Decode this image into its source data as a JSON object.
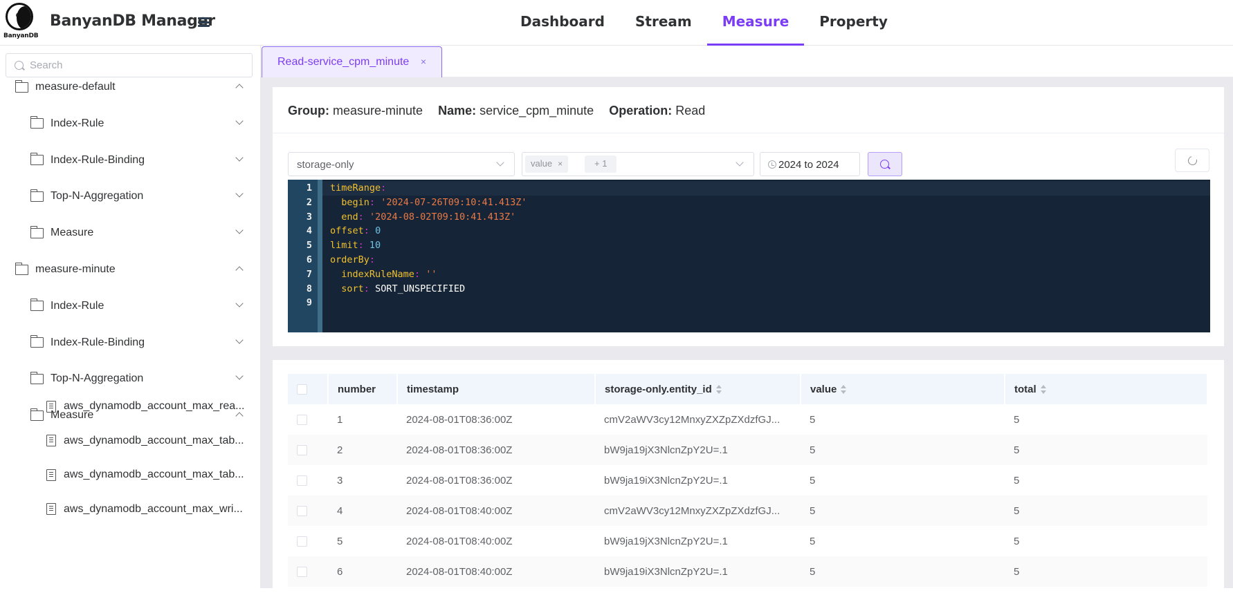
{
  "header": {
    "logo_text": "BanyanDB",
    "app_title": "BanyanDB Manager",
    "nav": [
      {
        "label": "Dashboard",
        "active": false
      },
      {
        "label": "Stream",
        "active": false
      },
      {
        "label": "Measure",
        "active": true
      },
      {
        "label": "Property",
        "active": false
      }
    ]
  },
  "sidebar": {
    "search_placeholder": "Search",
    "tree": [
      {
        "label": "measure-default",
        "level": 0,
        "icon": "folder-icon",
        "chevron": "up"
      },
      {
        "label": "Index-Rule",
        "level": 1,
        "icon": "folder-icon",
        "chevron": "down"
      },
      {
        "label": "Index-Rule-Binding",
        "level": 1,
        "icon": "folder-icon",
        "chevron": "down"
      },
      {
        "label": "Top-N-Aggregation",
        "level": 1,
        "icon": "folder-icon",
        "chevron": "down"
      },
      {
        "label": "Measure",
        "level": 1,
        "icon": "folder-icon",
        "chevron": "down"
      },
      {
        "label": "measure-minute",
        "level": 0,
        "icon": "folder-icon",
        "chevron": "up"
      },
      {
        "label": "Index-Rule",
        "level": 1,
        "icon": "folder-icon",
        "chevron": "down"
      },
      {
        "label": "Index-Rule-Binding",
        "level": 1,
        "icon": "folder-icon",
        "chevron": "down"
      },
      {
        "label": "Top-N-Aggregation",
        "level": 1,
        "icon": "folder-icon",
        "chevron": "down"
      },
      {
        "label": "Measure",
        "level": 1,
        "icon": "folder-icon",
        "chevron": "up"
      },
      {
        "label": "aws_dynamodb_account_max_rea...",
        "level": 2,
        "icon": "file-icon"
      },
      {
        "label": "aws_dynamodb_account_max_tab...",
        "level": 2,
        "icon": "file-icon"
      },
      {
        "label": "aws_dynamodb_account_max_tab...",
        "level": 2,
        "icon": "file-icon"
      },
      {
        "label": "aws_dynamodb_account_max_wri...",
        "level": 2,
        "icon": "file-icon"
      }
    ]
  },
  "tabs": [
    {
      "label": "Read-service_cpm_minute",
      "close": "×"
    }
  ],
  "info": {
    "group_label": "Group:",
    "group_value": "measure-minute",
    "name_label": "Name:",
    "name_value": "service_cpm_minute",
    "operation_label": "Operation:",
    "operation_value": "Read"
  },
  "query": {
    "tag_family_select": "storage-only",
    "fields_tags": [
      "value",
      "+ 1"
    ],
    "tag_close": "×",
    "date_range": "2024 to 2024"
  },
  "editor": {
    "lines": [
      {
        "n": "1",
        "indent": "",
        "key": "timeRange",
        "value": "",
        "vtype": ""
      },
      {
        "n": "2",
        "indent": "  ",
        "key": "begin",
        "value": "'2024-07-26T09:10:41.413Z'",
        "vtype": "s"
      },
      {
        "n": "3",
        "indent": "  ",
        "key": "end",
        "value": "'2024-08-02T09:10:41.413Z'",
        "vtype": "s"
      },
      {
        "n": "4",
        "indent": "",
        "key": "offset",
        "value": "0",
        "vtype": "n"
      },
      {
        "n": "5",
        "indent": "",
        "key": "limit",
        "value": "10",
        "vtype": "n"
      },
      {
        "n": "6",
        "indent": "",
        "key": "orderBy",
        "value": "",
        "vtype": ""
      },
      {
        "n": "7",
        "indent": "  ",
        "key": "indexRuleName",
        "value": "''",
        "vtype": "s"
      },
      {
        "n": "8",
        "indent": "  ",
        "key": "sort",
        "value": "SORT_UNSPECIFIED",
        "vtype": "w"
      },
      {
        "n": "9",
        "indent": "",
        "key": "",
        "value": "",
        "vtype": ""
      }
    ]
  },
  "table": {
    "columns": [
      {
        "label": "",
        "sortable": false
      },
      {
        "label": "number",
        "sortable": false
      },
      {
        "label": "timestamp",
        "sortable": false
      },
      {
        "label": "storage-only.entity_id",
        "sortable": true
      },
      {
        "label": "value",
        "sortable": true
      },
      {
        "label": "total",
        "sortable": true
      }
    ],
    "rows": [
      {
        "number": "1",
        "timestamp": "2024-08-01T08:36:00Z",
        "entity_id": "cmV2aWV3cy12MnxyZXZpZXdzfGJ...",
        "value": "5",
        "total": "5"
      },
      {
        "number": "2",
        "timestamp": "2024-08-01T08:36:00Z",
        "entity_id": "bW9ja19jX3NlcnZpY2U=.1",
        "value": "5",
        "total": "5"
      },
      {
        "number": "3",
        "timestamp": "2024-08-01T08:36:00Z",
        "entity_id": "bW9ja19iX3NlcnZpY2U=.1",
        "value": "5",
        "total": "5"
      },
      {
        "number": "4",
        "timestamp": "2024-08-01T08:40:00Z",
        "entity_id": "cmV2aWV3cy12MnxyZXZpZXdzfGJ...",
        "value": "5",
        "total": "5"
      },
      {
        "number": "5",
        "timestamp": "2024-08-01T08:40:00Z",
        "entity_id": "bW9ja19jX3NlcnZpY2U=.1",
        "value": "5",
        "total": "5"
      },
      {
        "number": "6",
        "timestamp": "2024-08-01T08:40:00Z",
        "entity_id": "bW9ja19iX3NlcnZpY2U=.1",
        "value": "5",
        "total": "5"
      }
    ]
  }
}
